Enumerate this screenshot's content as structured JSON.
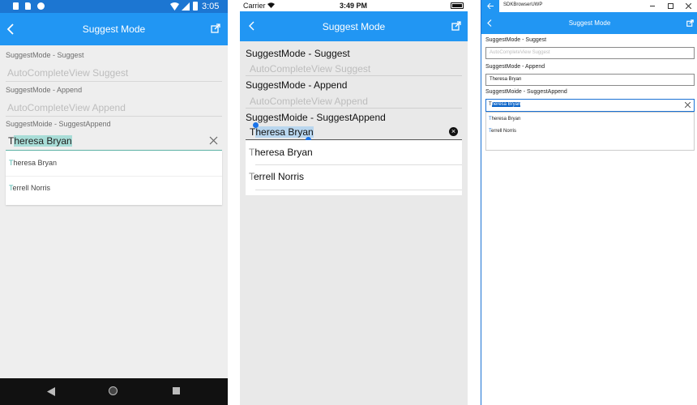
{
  "colors": {
    "primary": "#2196f3",
    "android_bg": "#eeeeee",
    "ios_bg": "#e9e9e9",
    "uwp_border": "#1b72d4"
  },
  "android": {
    "status": {
      "time": "3:05"
    },
    "title": "Suggest Mode",
    "suggest": {
      "label": "SuggestMode - Suggest",
      "placeholder": "AutoCompleteView Suggest"
    },
    "append": {
      "label": "SuggestMode - Append",
      "placeholder": "AutoCompleteView Append"
    },
    "suggestappend": {
      "label": "SuggestMoide - SuggestAppend",
      "typed": "T",
      "completion": "heresa Bryan"
    },
    "suggestions": [
      {
        "first": "T",
        "rest": "heresa Bryan"
      },
      {
        "first": "T",
        "rest": "errell Norris"
      }
    ]
  },
  "ios": {
    "status": {
      "carrier": "Carrier",
      "time": "3:49 PM"
    },
    "title": "Suggest Mode",
    "suggest": {
      "label": "SuggestMode - Suggest",
      "placeholder": "AutoCompleteView Suggest"
    },
    "append": {
      "label": "SuggestMode - Append",
      "placeholder": "AutoCompleteView Append"
    },
    "suggestappend": {
      "label": "SuggestMoide - SuggestAppend",
      "typed": "T",
      "completion": "heresa Bryan"
    },
    "suggestions": [
      {
        "first": "T",
        "rest": "heresa Bryan"
      },
      {
        "first": "T",
        "rest": "errell Norris"
      }
    ]
  },
  "uwp": {
    "window_title": "SDKBrowserUWP",
    "title": "Suggest Mode",
    "suggest": {
      "label": "SuggestMode - Suggest",
      "placeholder": "AutoCompleteView Suggest"
    },
    "append": {
      "label": "SuggestMode - Append",
      "value": "Theresa Bryan"
    },
    "suggestappend": {
      "label": "SuggestMoide - SuggestAppend",
      "typed": "T",
      "completion": "heresa Bryan"
    },
    "suggestions": [
      {
        "first": "T",
        "rest": "heresa Bryan"
      },
      {
        "first": "T",
        "rest": "errell Norris"
      }
    ]
  }
}
